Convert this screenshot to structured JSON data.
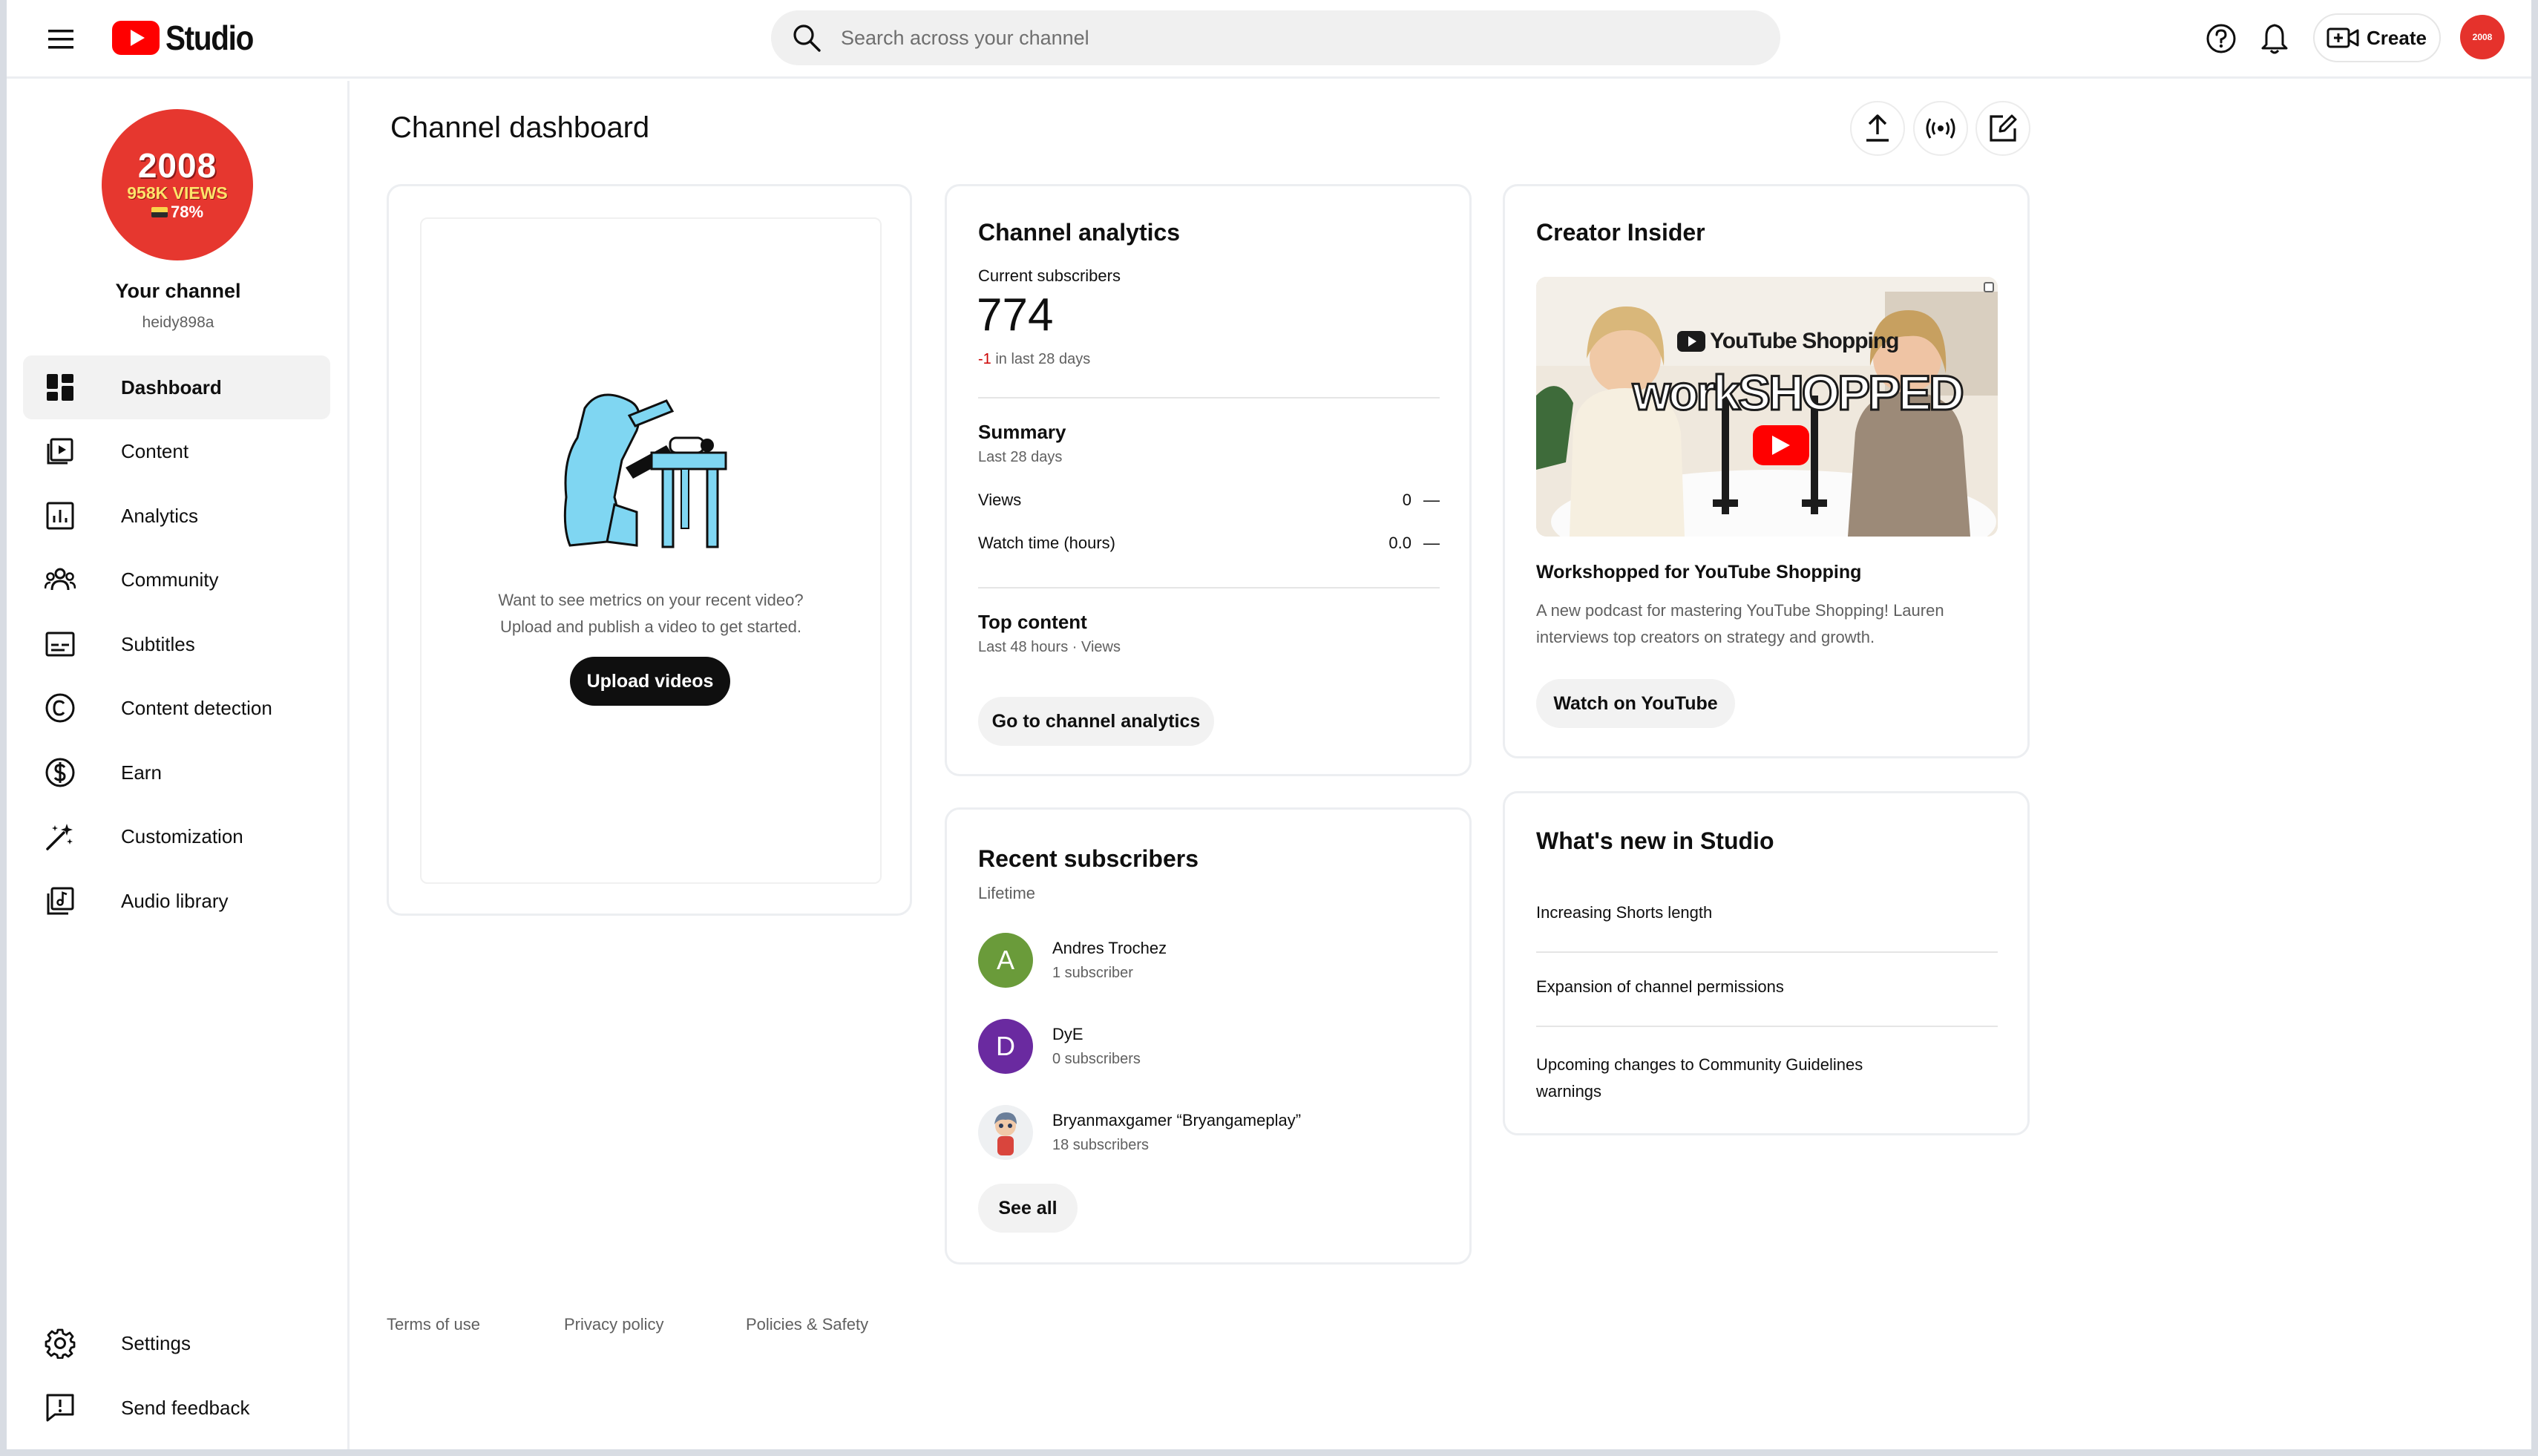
{
  "header": {
    "logo_text": "Studio",
    "search_placeholder": "Search across your channel",
    "create_label": "Create",
    "avatar_text": "2008"
  },
  "sidebar": {
    "channel_avatar": {
      "year": "2008",
      "views": "958K VIEWS",
      "pct": "78%"
    },
    "channel_title": "Your channel",
    "channel_handle": "heidy898a",
    "items": [
      {
        "label": "Dashboard",
        "icon": "dashboard-icon",
        "active": true
      },
      {
        "label": "Content",
        "icon": "content-icon"
      },
      {
        "label": "Analytics",
        "icon": "analytics-icon"
      },
      {
        "label": "Community",
        "icon": "community-icon"
      },
      {
        "label": "Subtitles",
        "icon": "subtitles-icon"
      },
      {
        "label": "Content detection",
        "icon": "copyright-icon"
      },
      {
        "label": "Earn",
        "icon": "dollar-icon"
      },
      {
        "label": "Customization",
        "icon": "magic-wand-icon"
      },
      {
        "label": "Audio library",
        "icon": "audio-library-icon"
      }
    ],
    "bottom_items": [
      {
        "label": "Settings",
        "icon": "gear-icon"
      },
      {
        "label": "Send feedback",
        "icon": "feedback-icon"
      }
    ]
  },
  "main": {
    "page_title": "Channel dashboard",
    "upload_card": {
      "text_line1": "Want to see metrics on your recent video?",
      "text_line2": "Upload and publish a video to get started.",
      "button": "Upload videos"
    },
    "analytics": {
      "title": "Channel analytics",
      "subs_label": "Current subscribers",
      "subs_value": "774",
      "subs_delta": "-1",
      "subs_delta_suffix": "in last 28 days",
      "summary_title": "Summary",
      "summary_period": "Last 28 days",
      "rows": [
        {
          "label": "Views",
          "value": "0",
          "trend": "—"
        },
        {
          "label": "Watch time (hours)",
          "value": "0.0",
          "trend": "—"
        }
      ],
      "top_content_title": "Top content",
      "top_content_sub": "Last 48 hours · Views",
      "button": "Go to channel analytics"
    },
    "recent_subscribers": {
      "title": "Recent subscribers",
      "period": "Lifetime",
      "items": [
        {
          "name": "Andres Trochez",
          "count": "1 subscriber",
          "initial": "A",
          "color": "#6a9b3a"
        },
        {
          "name": "DyE",
          "count": "0 subscribers",
          "initial": "D",
          "color": "#6a2aa0"
        },
        {
          "name": "Bryanmaxgamer “Bryangameplay”",
          "count": "18 subscribers",
          "initial": "",
          "color": "#e8e8e8"
        }
      ],
      "button": "See all"
    },
    "creator_insider": {
      "title": "Creator Insider",
      "thumb_brand": "YouTube Shopping",
      "thumb_headline": "workSHOPPED",
      "video_title": "Workshopped for YouTube Shopping",
      "desc_line1": "A new podcast for mastering YouTube Shopping! Lauren",
      "desc_line2": "interviews top creators on strategy and growth.",
      "button": "Watch on YouTube"
    },
    "whats_new": {
      "title": "What's new in Studio",
      "items": [
        "Increasing Shorts length",
        "Expansion of channel permissions",
        "Upcoming changes to Community Guidelines",
        "warnings"
      ]
    }
  },
  "footer": {
    "links": [
      "Terms of use",
      "Privacy policy",
      "Policies & Safety"
    ]
  },
  "colors": {
    "brand_red": "#ff0000",
    "delta_red": "#cc0000",
    "text_primary": "#0f0f0f",
    "text_secondary": "#606060"
  }
}
